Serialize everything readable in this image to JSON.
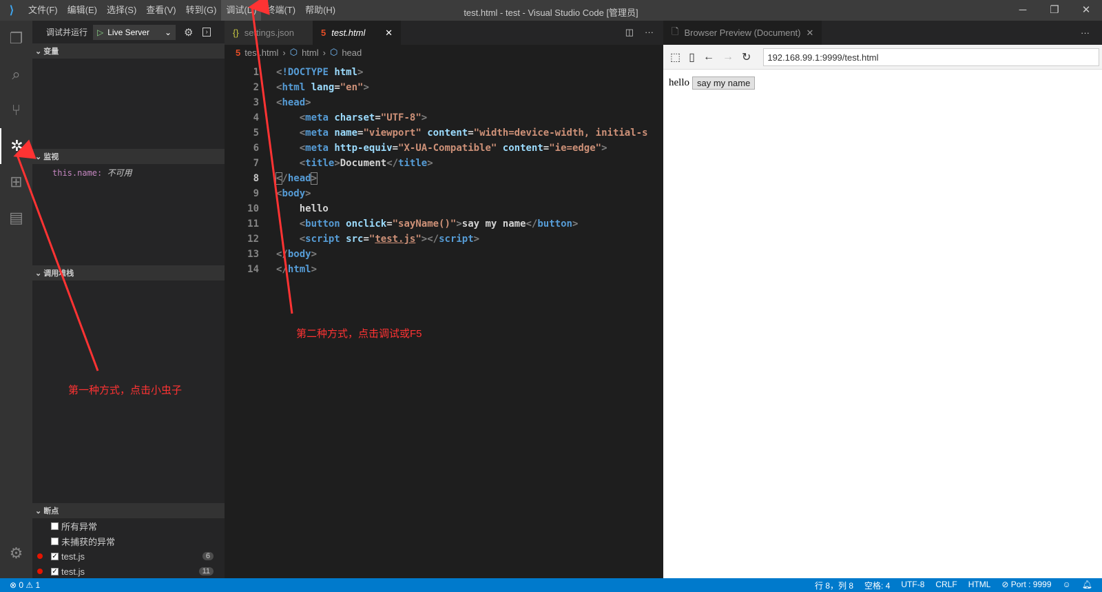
{
  "titlebar": {
    "menus": [
      "文件(F)",
      "编辑(E)",
      "选择(S)",
      "查看(V)",
      "转到(G)",
      "调试(D)",
      "终端(T)",
      "帮助(H)"
    ],
    "title": "test.html - test - Visual Studio Code [管理员]"
  },
  "sidebar": {
    "run_label": "调试并运行",
    "config": "Live Server",
    "sections": {
      "variables": "变量",
      "watch": "监视",
      "callstack": "调用堆栈",
      "breakpoints": "断点"
    },
    "watch_expr": "this.name:",
    "watch_value": "不可用",
    "breakpoints": [
      {
        "label": "所有异常",
        "checked": false
      },
      {
        "label": "未捕获的异常",
        "checked": false
      },
      {
        "label": "test.js",
        "checked": true,
        "line": "6"
      },
      {
        "label": "test.js",
        "checked": true,
        "line": "11"
      }
    ]
  },
  "editor": {
    "tabs": [
      "settings.json",
      "test.html"
    ],
    "breadcrumb": [
      "test.html",
      "html",
      "head"
    ],
    "lines": [
      "1",
      "2",
      "3",
      "4",
      "5",
      "6",
      "7",
      "8",
      "9",
      "10",
      "11",
      "12",
      "13",
      "14"
    ]
  },
  "browser": {
    "tab": "Browser Preview (Document)",
    "url": "192.168.99.1:9999/test.html",
    "text": "hello",
    "button": "say my name"
  },
  "status": {
    "errors": "0",
    "warnings": "1",
    "position": "行 8，列 8",
    "spaces": "空格: 4",
    "encoding": "UTF-8",
    "eol": "CRLF",
    "language": "HTML",
    "port": "Port : 9999"
  },
  "annotations": {
    "first": "第一种方式，点击小虫子",
    "second": "第二种方式，点击调试或F5"
  }
}
